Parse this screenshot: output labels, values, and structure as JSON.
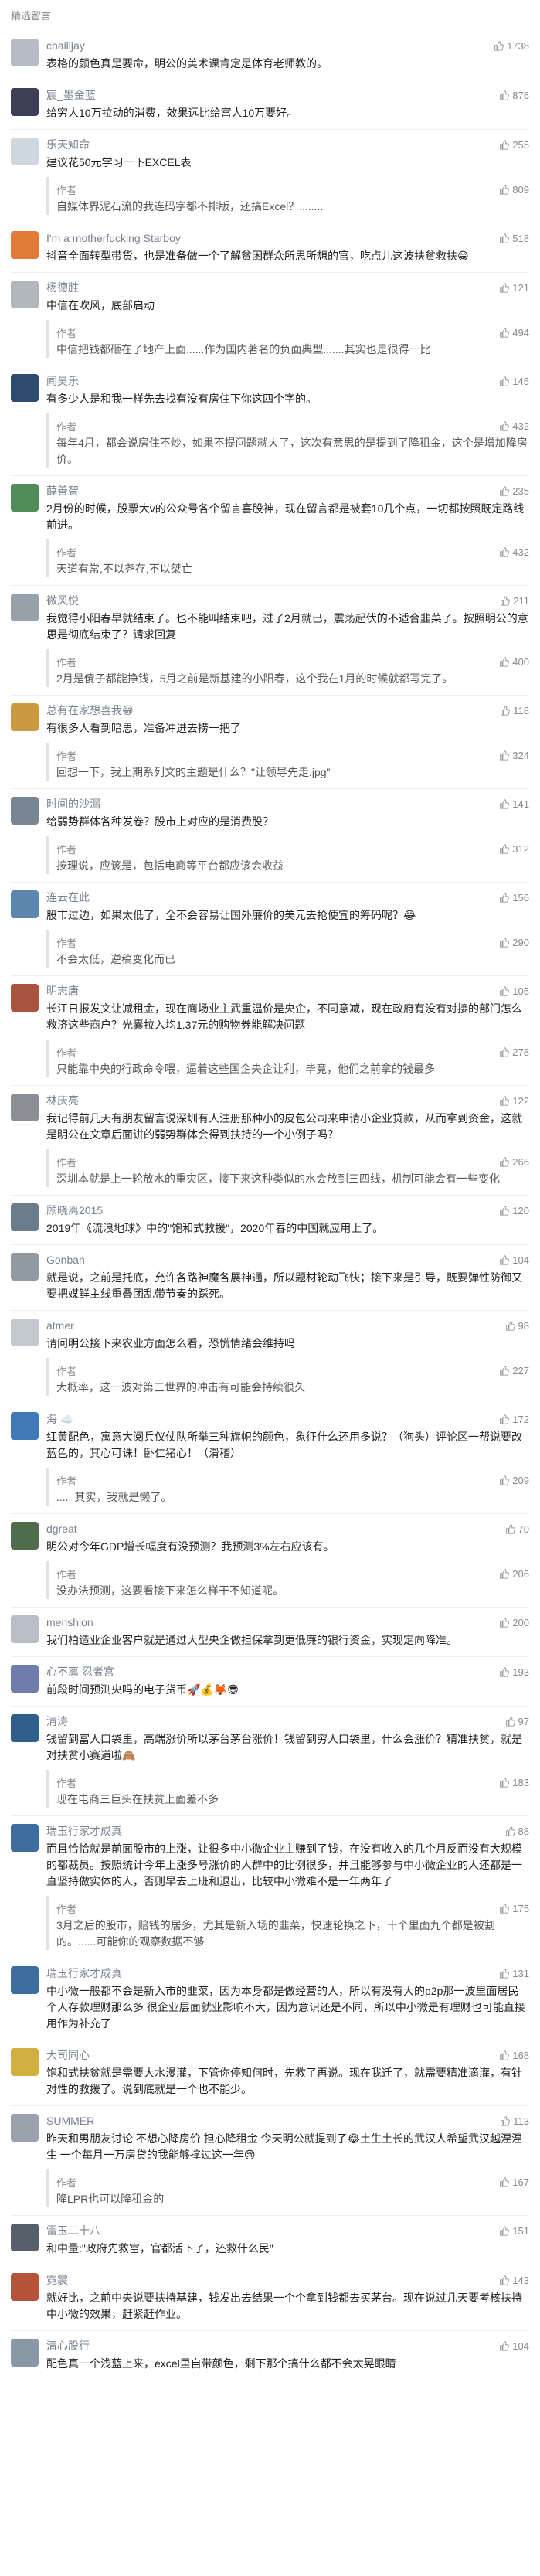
{
  "header": {
    "title": "精选留言"
  },
  "comments": [
    {
      "name": "chailijay",
      "likes": "1738",
      "avatar_color": "#b5bcc6",
      "text": "表格的颜色真是要命，明公的美术课肯定是体育老师教的。",
      "reply": null
    },
    {
      "name": "宸_墨金蓝",
      "likes": "876",
      "avatar_color": "#3c3f54",
      "text": "给穷人10万拉动的消费，效果远比给富人10万要好。",
      "reply": null
    },
    {
      "name": "乐天知命",
      "likes": "255",
      "avatar_color": "#cfd7de",
      "text": "建议花50元学习一下EXCEL表",
      "reply": {
        "label": "作者",
        "likes": "809",
        "text": "自媒体界泥石流的我连码字都不排版，还搞Excel？........"
      }
    },
    {
      "name": "I'm a motherfucking Starboy",
      "likes": "518",
      "avatar_color": "#e07b39",
      "text": "抖音全面转型带货，也是准备做一个了解贫困群众所思所想的官，吃点儿这波扶贫救扶😁",
      "reply": null
    },
    {
      "name": "杨德胜",
      "likes": "121",
      "avatar_color": "#b2b7bd",
      "text": "中信在吹风，底部启动",
      "reply": {
        "label": "作者",
        "likes": "494",
        "text": "中信把钱都砸在了地产上面......作为国内著名的负面典型.......其实也是很得一比"
      }
    },
    {
      "name": "闻昊乐",
      "likes": "145",
      "avatar_color": "#2d4a6f",
      "text": "有多少人是和我一样先去找有没有房住下你这四个字的。",
      "reply": {
        "label": "作者",
        "likes": "432",
        "text": "每年4月，都会说房住不炒，如果不提问题就大了，这次有意思的是提到了降租金，这个是增加降房价。"
      }
    },
    {
      "name": "薛善智",
      "likes": "235",
      "avatar_color": "#4f8c5a",
      "text": "2月份的时候，股票大v的公众号各个留言喜股神，现在留言都是被套10几个点，一切都按照既定路线前进。",
      "reply": {
        "label": "作者",
        "likes": "432",
        "text": "天道有常,不以尧存,不以桀亡"
      }
    },
    {
      "name": "微风悦",
      "likes": "211",
      "avatar_color": "#97a1aa",
      "text": "我觉得小阳春早就结束了。也不能叫结束吧，过了2月就已，震荡起伏的不适合韭菜了。按照明公的意思是彻底结束了？请求回复",
      "reply": {
        "label": "作者",
        "likes": "400",
        "text": "2月是傻子都能挣钱，5月之前是新基建的小阳春，这个我在1月的时候就都写完了。"
      }
    },
    {
      "name": "总有在家想喜我😁",
      "likes": "118",
      "avatar_color": "#c99a3f",
      "text": "有很多人看到暗思，准备冲进去捞一把了",
      "reply": {
        "label": "作者",
        "likes": "324",
        "text": "回想一下，我上期系列文的主题是什么？\"让领导先走.jpg\""
      }
    },
    {
      "name": "时间的沙漏",
      "likes": "141",
      "avatar_color": "#7a8594",
      "text": "给弱势群体各种发卷？股市上对应的是消费股？",
      "reply": {
        "label": "作者",
        "likes": "312",
        "text": "按理说，应该是，包括电商等平台都应该会收益"
      }
    },
    {
      "name": "连云在此",
      "likes": "156",
      "avatar_color": "#5e87b0",
      "text": "股市过边，如果太低了，全不会容易让国外廉价的美元去抢便宜的筹码呢？😂",
      "reply": {
        "label": "作者",
        "likes": "290",
        "text": "不会太低，逆稿变化而已"
      }
    },
    {
      "name": "明志唐",
      "likes": "105",
      "avatar_color": "#a8543f",
      "text": "长江日报发文让减租金，现在商场业主武重温价是央企，不同意减，现在政府有没有对接的部门怎么救济这些商户？光囊拉入均1.37元的购物券能解决问题",
      "reply": {
        "label": "作者",
        "likes": "278",
        "text": "只能靠中央的行政命令喂，逼着这些国企央企让利，毕竟，他们之前拿的钱最多"
      }
    },
    {
      "name": "林庆亮",
      "likes": "122",
      "avatar_color": "#8b8f93",
      "text": "我记得前几天有朋友留言说深圳有人注册那种小的皮包公司来申请小企业贷款，从而拿到资金，这就是明公在文章后面讲的弱势群体会得到扶持的一个小例子吗？",
      "reply": {
        "label": "作者",
        "likes": "266",
        "text": "深圳本就是上一轮放水的重灾区，接下来这种类似的水会放到三四线，机制可能会有一些变化"
      }
    },
    {
      "name": "顾晓离2015",
      "likes": "120",
      "avatar_color": "#6b7c8c",
      "text": "2019年《流浪地球》中的\"饱和式救援\"，2020年春的中国就应用上了。",
      "reply": null
    },
    {
      "name": "Gonban",
      "likes": "104",
      "avatar_color": "#909aa3",
      "text": "就是说，之前是托底，允许各路神魔各展神通，所以题材轮动飞快；接下来是引导，既要弹性防御又要把媒鲜主线重叠团乱带节奏的踩死。",
      "reply": null
    },
    {
      "name": "atmer",
      "likes": "98",
      "avatar_color": "#c2c8ce",
      "text": "请问明公接下来农业方面怎么看，恐慌情绪会维持吗",
      "reply": {
        "label": "作者",
        "likes": "227",
        "text": "大概率，这一波对第三世界的冲击有可能会持续很久"
      }
    },
    {
      "name": "海 ☁️",
      "likes": "172",
      "avatar_color": "#3f79b8",
      "text": "红黄配色，寓意大阅兵仪仗队所举三种旗帜的颜色，象征什么还用多说？（狗头）评论区一帮说要改蓝色的，其心可诛！卧仁猪心！（滑稽）",
      "reply": {
        "label": "作者",
        "likes": "209",
        "text": ".....  其实，我就是懒了。"
      }
    },
    {
      "name": "dgreat",
      "likes": "70",
      "avatar_color": "#4f6d4d",
      "text": "明公对今年GDP增长幅度有没预测？我预测3%左右应该有。",
      "reply": {
        "label": "作者",
        "likes": "206",
        "text": "没办法预测，这要看接下来怎么样干不知道呢。"
      }
    },
    {
      "name": "menshion",
      "likes": "200",
      "avatar_color": "#b7bec5",
      "text": "我们柏造业企业客户就是通过大型央企做担保拿到更低廉的银行资金，实现定向降准。",
      "reply": null
    },
    {
      "name": "心不离 忍者宫",
      "likes": "193",
      "avatar_color": "#6e7dac",
      "text": "前段时间预测央吗的电子货币🚀💰🦊😎",
      "reply": null
    },
    {
      "name": "清涛",
      "likes": "97",
      "avatar_color": "#2f5f8a",
      "text": "钱留到富人口袋里，高端涨价所以茅台茅台涨价！钱留到穷人口袋里，什么会涨价？精准扶贫，就是对扶贫小赛道啦🙈",
      "reply": {
        "label": "作者",
        "likes": "183",
        "text": "现在电商三巨头在扶贫上面差不多"
      }
    },
    {
      "name": "瑞玉行家才成真",
      "likes": "88",
      "avatar_color": "#3d6c9e",
      "text": "而且恰恰就是前面股市的上涨，让很多中小微企业主赚到了钱，在没有收入的几个月反而没有大规模的都裁员。按照统计今年上涨多号涨价的人群中的比例很多，并且能够参与中小微企业的人还都是一直坚持做实体的人，否则早去上班和退出，比较中小微难不是一年两年了",
      "reply": {
        "label": "作者",
        "likes": "175",
        "text": "3月之后的股市，赔钱的居多，尤其是新入场的韭菜，快速轮换之下，十个里面九个都是被割的。......可能你的观察数据不够"
      }
    },
    {
      "name": "瑞玉行家才成真",
      "likes": "131",
      "avatar_color": "#3d6c9e",
      "text": "中小微一般都不会是新入市的韭菜，因为本身都是做经营的人，所以有没有大的p2p那一波里面居民个人存款理财那么多 很企业层面就业影响不大，因为意识还是不同，所以中小微是有理财也可能直接用作为补充了",
      "reply": null
    },
    {
      "name": "大司同心",
      "likes": "168",
      "avatar_color": "#d2b040",
      "text": "饱和式扶贫就是需要大水漫灌，下管你停知何时，先救了再说。现在我迁了，就需要精准滴灌，有针对性的救援了。说到底就是一个也不能少。",
      "reply": null
    },
    {
      "name": "SUMMER",
      "likes": "113",
      "avatar_color": "#9aa3ab",
      "text": "昨天和男朋友讨论 不想心降房价 担心降租金 今天明公就提到了😂土生土长的武汉人希望武汉越涅涅生 一个每月一万房贷的我能够撑过这一年😢",
      "reply": {
        "label": "作者",
        "likes": "167",
        "text": "降LPR也可以降租金的"
      }
    },
    {
      "name": "雷玉二十八",
      "likes": "151",
      "avatar_color": "#55606b",
      "text": "和中量:\"政府先救富，官都活下了，还救什么民\"",
      "reply": null
    },
    {
      "name": "霓裳",
      "likes": "143",
      "avatar_color": "#b4533a",
      "text": "就好比，之前中央说要扶持基建，钱发出去结果一个个拿到钱都去买茅台。现在说过几天要考核扶持中小微的效果，赶紧赶作业。",
      "reply": null
    },
    {
      "name": "清心股行",
      "likes": "104",
      "avatar_color": "#8a97a4",
      "text": "配色真一个浅蓝上来，excel里自带颜色，剩下那个搞什么都不会太晃眼睛",
      "reply": null
    }
  ]
}
